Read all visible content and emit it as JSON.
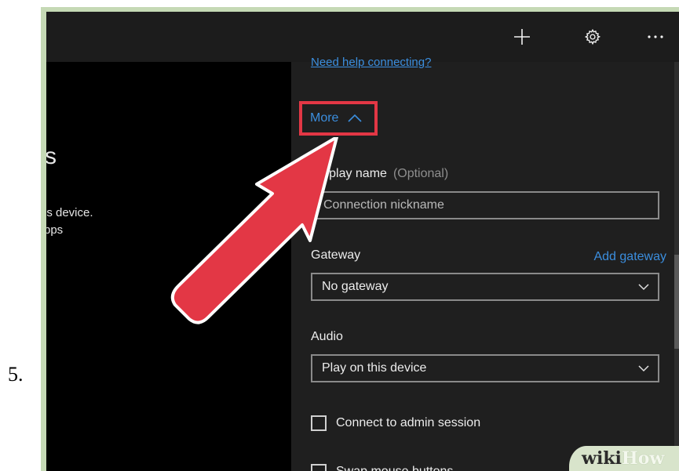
{
  "step": {
    "number": "5."
  },
  "titlebar": {
    "add_icon": "plus-icon",
    "settings_icon": "gear-icon",
    "more_icon": "ellipsis-icon"
  },
  "left_pane": {
    "title_fragment": "s",
    "line1": "is device.",
    "line2": "pps"
  },
  "connection": {
    "help_link": "Need help connecting?",
    "more_label": "More",
    "more_icon": "chevron-up-icon",
    "display_name": {
      "label": "Display name",
      "optional": "(Optional)",
      "placeholder": "Connection nickname"
    },
    "gateway": {
      "label": "Gateway",
      "add_label": "Add gateway",
      "selected": "No gateway"
    },
    "audio": {
      "label": "Audio",
      "selected": "Play on this device"
    },
    "admin_session": {
      "label": "Connect to admin session",
      "checked": false
    },
    "swap_mouse": {
      "label": "Swap mouse buttons",
      "checked": false
    }
  },
  "annotation": {
    "arrow_color": "#e33745",
    "highlight_color": "#e33745"
  },
  "watermark": {
    "wiki": "wiki",
    "how": "How"
  },
  "colors": {
    "accent": "#3b8ede",
    "pane_bg": "#1f1f1f",
    "left_bg": "#000000"
  }
}
